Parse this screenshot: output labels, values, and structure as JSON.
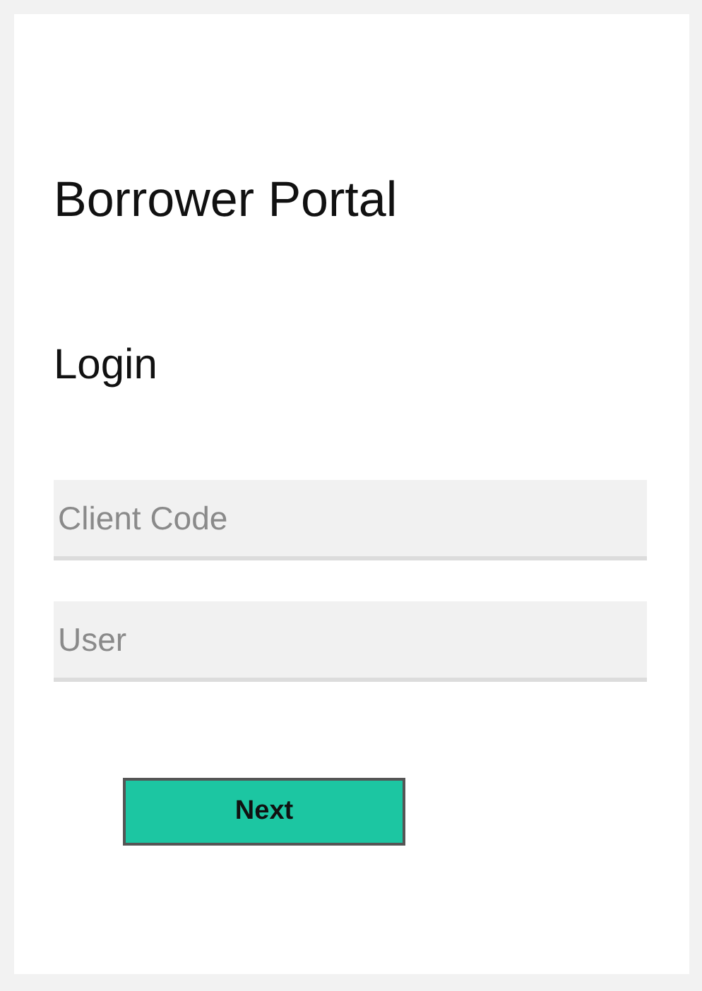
{
  "title": "Borrower Portal",
  "subtitle": "Login",
  "fields": [
    {
      "placeholder": "Client Code"
    },
    {
      "placeholder": "User"
    }
  ],
  "button": {
    "label": "Next"
  }
}
